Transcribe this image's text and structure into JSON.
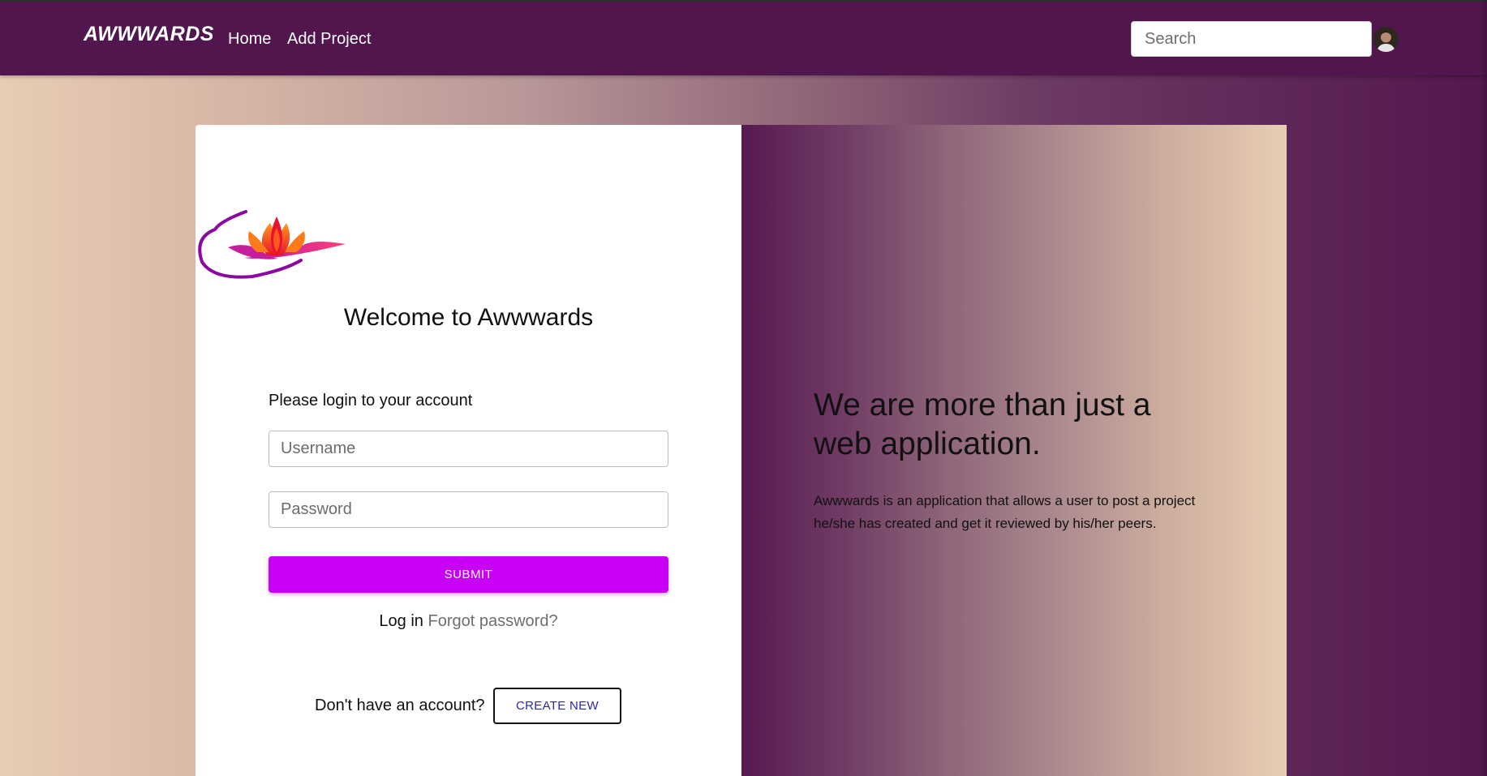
{
  "navbar": {
    "brand": "AWWWARDS",
    "links": [
      {
        "label": "Home"
      },
      {
        "label": "Add Project"
      }
    ],
    "search": {
      "placeholder": "Search",
      "value": ""
    },
    "avatar": {
      "icon": "user-avatar"
    }
  },
  "login": {
    "logo": {
      "icon": "lotus-logo"
    },
    "welcome_title": "Welcome to Awwwards",
    "prompt": "Please login to your account",
    "username": {
      "placeholder": "Username",
      "value": ""
    },
    "password": {
      "placeholder": "Password",
      "value": ""
    },
    "submit_label": "SUBMIT",
    "login_link": "Log in",
    "forgot_link": "Forgot password?",
    "signup_prompt": "Don't have an account?",
    "create_label": "CREATE NEW"
  },
  "promo": {
    "headline": "We are more than just a web application.",
    "description": "Awwwards is an application that allows a user to post a project he/she has created and get it reviewed by his/her peers."
  },
  "colors": {
    "navbar": "#51164d",
    "submit_button": "#c800f5",
    "create_button_text": "#2a2aa8",
    "gradient_light": "#e7cdb4",
    "gradient_dark": "#53174d"
  }
}
